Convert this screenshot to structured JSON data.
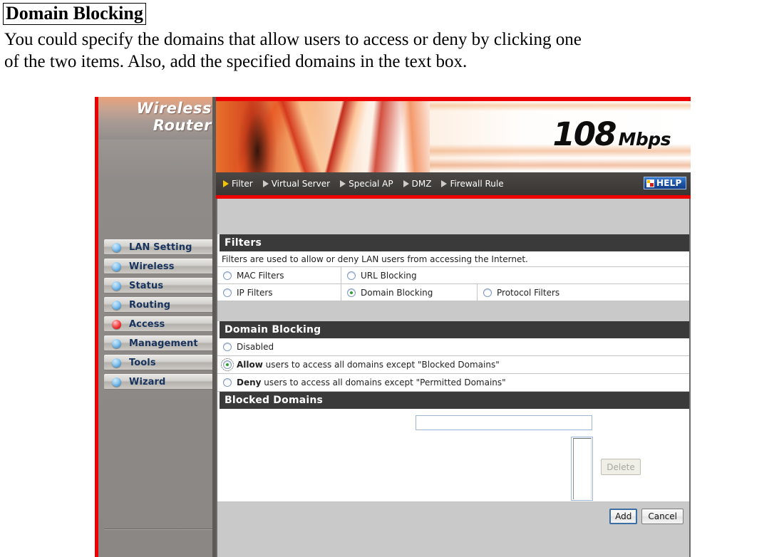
{
  "document": {
    "title": "Domain Blocking",
    "paragraph_line1": "You could specify the domains that allow users to access or deny by clicking one",
    "paragraph_line2": "of the two items.  Also, add the specified domains in the text box."
  },
  "router_ui": {
    "logo_line1": "Wireless",
    "logo_line2": "Router",
    "banner": {
      "speed_number": "108",
      "speed_unit": "Mbps"
    },
    "nav": {
      "items": [
        {
          "label": "Filter",
          "active": true
        },
        {
          "label": "Virtual Server",
          "active": false
        },
        {
          "label": "Special AP",
          "active": false
        },
        {
          "label": "DMZ",
          "active": false
        },
        {
          "label": "Firewall Rule",
          "active": false
        }
      ],
      "help_label": "HELP"
    },
    "sidebar": {
      "items": [
        {
          "label": "LAN Setting",
          "active": false
        },
        {
          "label": "Wireless",
          "active": false
        },
        {
          "label": "Status",
          "active": false
        },
        {
          "label": "Routing",
          "active": false
        },
        {
          "label": "Access",
          "active": true
        },
        {
          "label": "Management",
          "active": false
        },
        {
          "label": "Tools",
          "active": false
        },
        {
          "label": "Wizard",
          "active": false
        }
      ]
    },
    "filters_section": {
      "heading": "Filters",
      "description": "Filters are used to allow or deny LAN users from accessing the Internet.",
      "row1": [
        {
          "label": "MAC Filters",
          "selected": false
        },
        {
          "label": "URL Blocking",
          "selected": false
        }
      ],
      "row2": [
        {
          "label": "IP Filters",
          "selected": false
        },
        {
          "label": "Domain Blocking",
          "selected": true
        },
        {
          "label": "Protocol Filters",
          "selected": false
        }
      ]
    },
    "domain_blocking_section": {
      "heading": "Domain Blocking",
      "options": [
        {
          "label": "Disabled",
          "bold_prefix": "",
          "selected": false,
          "focused": false
        },
        {
          "label": " users to access all domains except \"Blocked Domains\"",
          "bold_prefix": "Allow",
          "selected": true,
          "focused": true
        },
        {
          "label": " users to access all domains except \"Permitted Domains\"",
          "bold_prefix": "Deny",
          "selected": false,
          "focused": false
        }
      ]
    },
    "blocked_domains_section": {
      "heading": "Blocked Domains",
      "domain_input_value": "",
      "domain_input_placeholder": "",
      "list_items": [],
      "delete_label": "Delete"
    },
    "footer": {
      "add_label": "Add",
      "cancel_label": "Cancel"
    },
    "colors": {
      "accent_red": "#ee0000",
      "section_header": "#3a3a3a",
      "panel_gray": "#c9c9c9",
      "sidebar_label": "#17335e",
      "radio_selected": "#2aa22a",
      "active_nav_arrow": "#f5c400"
    }
  }
}
